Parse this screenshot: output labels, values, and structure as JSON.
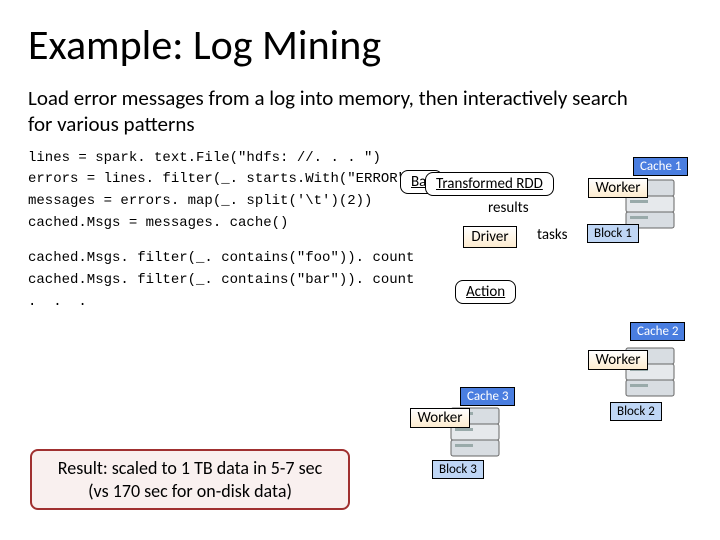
{
  "title": "Example: Log Mining",
  "subtitle": "Load error messages from a log into memory, then interactively search for various patterns",
  "code": {
    "l1": "lines = spark. text.File(\"hdfs: //. . . \")",
    "l2": "errors = lines. filter(_. starts.With(\"ERROR\"))",
    "l3": "messages = errors. map(_. split('\\t')(2))",
    "l4": "cached.Msgs = messages. cache()",
    "l5": "cached.Msgs. filter(_. contains(\"foo\")). count",
    "l6": "cached.Msgs. filter(_. contains(\"bar\")). count",
    "l7": ".  .  ."
  },
  "result": {
    "line1": "Result: scaled to 1 TB data in 5-7 sec",
    "line2": "(vs 170 sec for on-disk data)"
  },
  "labels": {
    "base": "Bas",
    "transformed_rdd": "Transformed RDD",
    "action": "Action",
    "results": "results",
    "tasks": "tasks"
  },
  "nodes": {
    "driver": "Driver",
    "worker": "Worker",
    "cache1": "Cache 1",
    "cache2": "Cache 2",
    "cache3": "Cache 3",
    "block1": "Block 1",
    "block2": "Block 2",
    "block3": "Block 3"
  }
}
